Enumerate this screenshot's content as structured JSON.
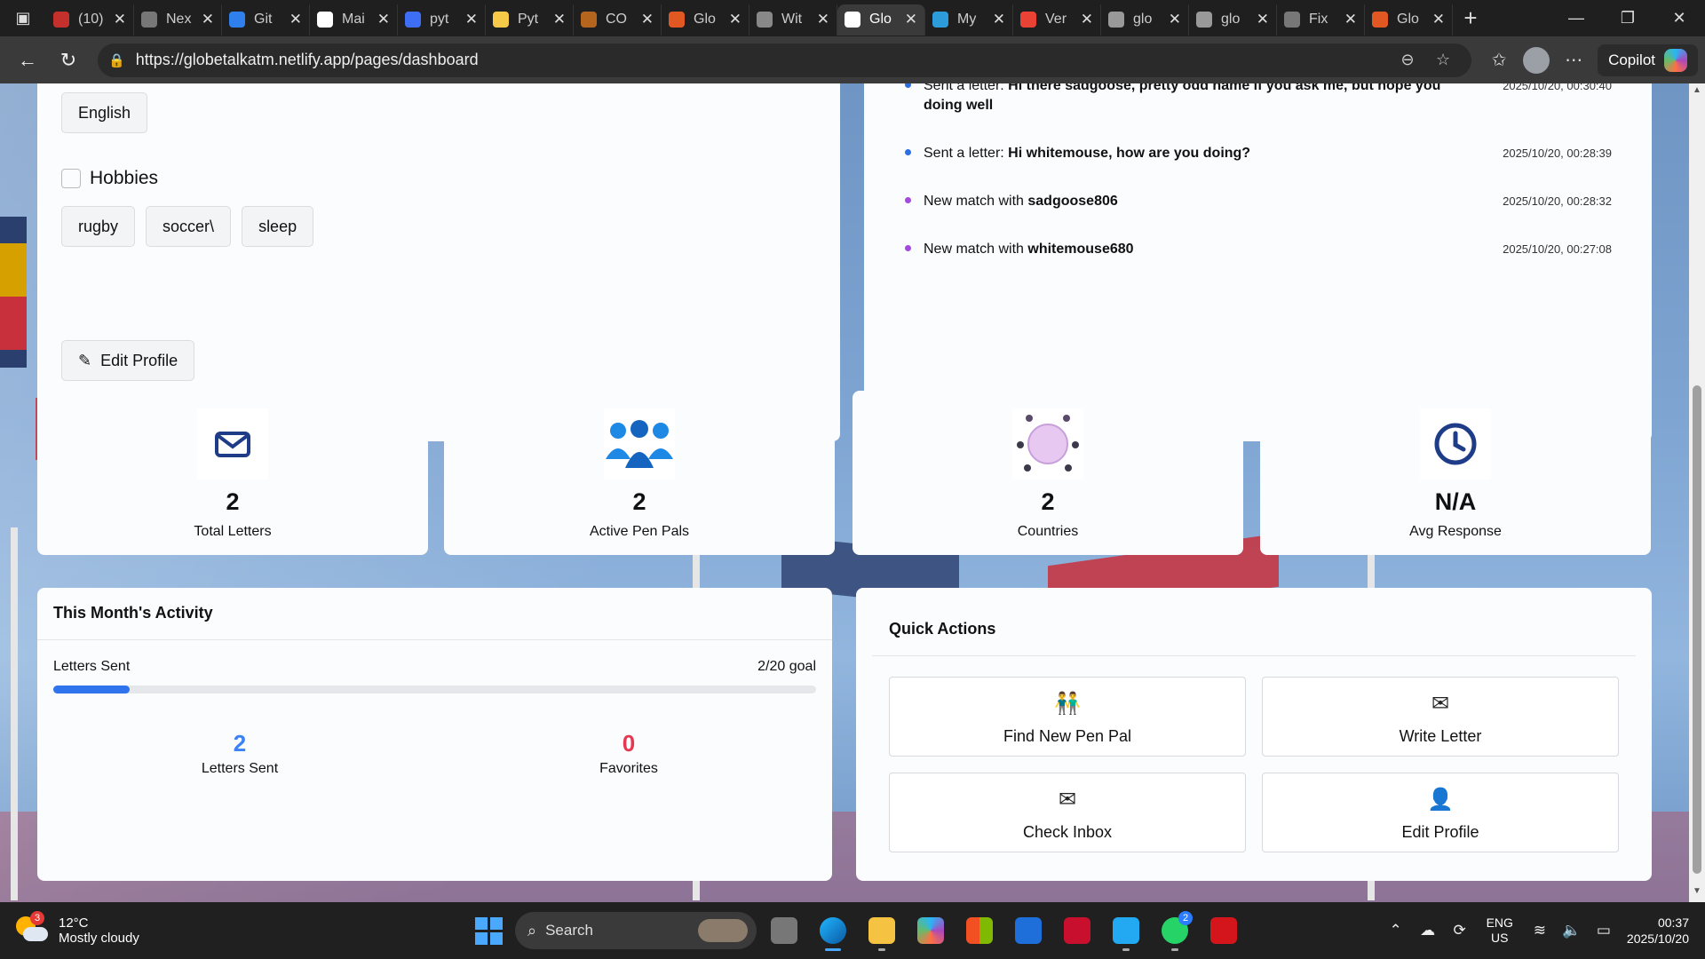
{
  "browser": {
    "tabs": [
      {
        "title": "(10)",
        "color": "#c4302b",
        "active": false
      },
      {
        "title": "Nex",
        "color": "#777777",
        "active": false
      },
      {
        "title": "Git",
        "color": "#2f80ed",
        "active": false
      },
      {
        "title": "Mai",
        "color": "#ffffff",
        "active": false
      },
      {
        "title": "pyt",
        "color": "#3d6ef5",
        "active": false
      },
      {
        "title": "Pyt",
        "color": "#f7c948",
        "active": false
      },
      {
        "title": "CO",
        "color": "#b5651d",
        "active": false
      },
      {
        "title": "Glo",
        "color": "#e25822",
        "active": false
      },
      {
        "title": "Wit",
        "color": "#888888",
        "active": false
      },
      {
        "title": "Glo",
        "color": "#ffffff",
        "active": true
      },
      {
        "title": "My",
        "color": "#2d9cdb",
        "active": false
      },
      {
        "title": "Ver",
        "color": "#ea4335",
        "active": false
      },
      {
        "title": "glo",
        "color": "#999999",
        "active": false
      },
      {
        "title": "glo",
        "color": "#999999",
        "active": false
      },
      {
        "title": "Fix",
        "color": "#777777",
        "active": false
      },
      {
        "title": "Glo",
        "color": "#e25822",
        "active": false
      }
    ],
    "url": "https://globetalkatm.netlify.app/pages/dashboard",
    "copilot_label": "Copilot"
  },
  "profile": {
    "language_chip": "English",
    "hobbies_label": "Hobbies",
    "hobbies": [
      "rugby",
      "soccer\\",
      "sleep"
    ],
    "edit_button": "Edit Profile"
  },
  "activity": [
    {
      "prefix": "Sent a letter: ",
      "bold": "Hi there sadgoose, pretty odd name if you ask me, but hope you doing well",
      "time": "2025/10/20, 00:30:40",
      "dot": "#2b6fe0"
    },
    {
      "prefix": "Sent a letter: ",
      "bold": "Hi whitemouse, how are you doing?",
      "time": "2025/10/20, 00:28:39",
      "dot": "#2b6fe0"
    },
    {
      "prefix": "New match with ",
      "bold": "sadgoose806",
      "time": "2025/10/20, 00:28:32",
      "dot": "#a548e0"
    },
    {
      "prefix": "New match with ",
      "bold": "whitemouse680",
      "time": "2025/10/20, 00:27:08",
      "dot": "#a548e0"
    }
  ],
  "stats": [
    {
      "value": "2",
      "label": "Total Letters",
      "icon": "envelope-icon"
    },
    {
      "value": "2",
      "label": "Active Pen Pals",
      "icon": "people-icon"
    },
    {
      "value": "2",
      "label": "Countries",
      "icon": "globe-people-icon"
    },
    {
      "value": "N/A",
      "label": "Avg Response",
      "icon": "clock-icon"
    }
  ],
  "month_activity": {
    "title": "This Month's Activity",
    "progress_label": "Letters Sent",
    "progress_goal": "2/20 goal",
    "progress_fraction": 0.1,
    "metrics": [
      {
        "value": "2",
        "label": "Letters Sent",
        "color": "#3b82f6"
      },
      {
        "value": "0",
        "label": "Favorites",
        "color": "#e53950"
      }
    ]
  },
  "quick_actions": {
    "title": "Quick Actions",
    "buttons": [
      {
        "label": "Find New Pen Pal",
        "icon": "pen-pal-icon"
      },
      {
        "label": "Write Letter",
        "icon": "letters-icon"
      },
      {
        "label": "Check Inbox",
        "icon": "open-envelope-icon"
      },
      {
        "label": "Edit Profile",
        "icon": "user-edit-icon"
      }
    ]
  },
  "taskbar": {
    "weather_temp": "12°C",
    "weather_desc": "Mostly cloudy",
    "weather_badge": "3",
    "search_label": "Search",
    "whatsapp_badge": "2",
    "lang_top": "ENG",
    "lang_bottom": "US",
    "time": "00:37",
    "date": "2025/10/20"
  }
}
